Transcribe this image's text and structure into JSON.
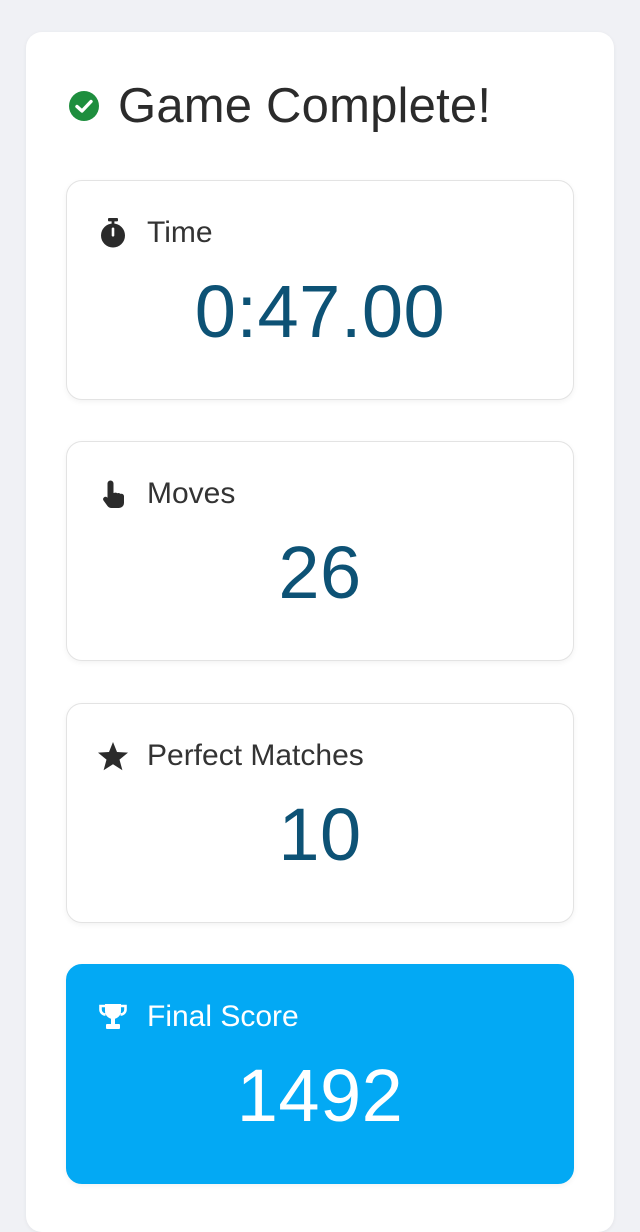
{
  "header": {
    "title": "Game Complete!",
    "icon": "check-circle-icon",
    "icon_color": "#1e8e3e"
  },
  "stats": [
    {
      "label": "Time",
      "value": "0:47.00",
      "icon": "stopwatch-icon"
    },
    {
      "label": "Moves",
      "value": "26",
      "icon": "pointing-hand-icon"
    },
    {
      "label": "Perfect Matches",
      "value": "10",
      "icon": "star-icon"
    },
    {
      "label": "Final Score",
      "value": "1492",
      "icon": "trophy-icon"
    }
  ],
  "colors": {
    "value_text": "#0d5275",
    "final_card_bg": "#03a9f4",
    "page_bg": "#f0f1f5"
  }
}
